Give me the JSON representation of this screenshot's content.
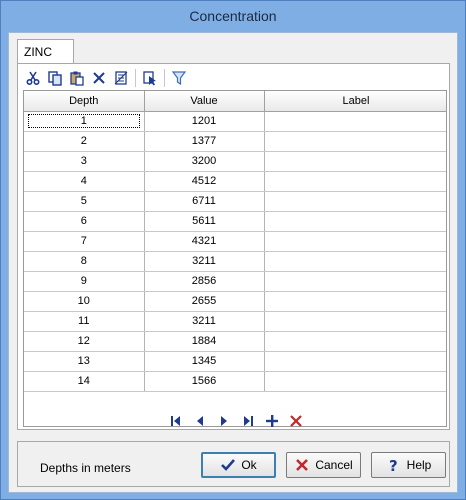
{
  "window": {
    "title": "Concentration"
  },
  "tabs": [
    {
      "label": "ZINC"
    }
  ],
  "toolbar": {
    "items": [
      "cut-icon",
      "copy-icon",
      "paste-icon",
      "delete-icon",
      "clear-icon",
      "select-icon",
      "filter-icon"
    ]
  },
  "grid": {
    "columns": [
      "Depth",
      "Value",
      "Label"
    ],
    "rows": [
      {
        "depth": "1",
        "value": "1201",
        "label": ""
      },
      {
        "depth": "2",
        "value": "1377",
        "label": ""
      },
      {
        "depth": "3",
        "value": "3200",
        "label": ""
      },
      {
        "depth": "4",
        "value": "4512",
        "label": ""
      },
      {
        "depth": "5",
        "value": "6711",
        "label": ""
      },
      {
        "depth": "6",
        "value": "5611",
        "label": ""
      },
      {
        "depth": "7",
        "value": "4321",
        "label": ""
      },
      {
        "depth": "8",
        "value": "3211",
        "label": ""
      },
      {
        "depth": "9",
        "value": "2856",
        "label": ""
      },
      {
        "depth": "10",
        "value": "2655",
        "label": ""
      },
      {
        "depth": "11",
        "value": "3211",
        "label": ""
      },
      {
        "depth": "12",
        "value": "1884",
        "label": ""
      },
      {
        "depth": "13",
        "value": "1345",
        "label": ""
      },
      {
        "depth": "14",
        "value": "1566",
        "label": ""
      }
    ]
  },
  "navigator": {
    "items": [
      "first-record-icon",
      "prior-record-icon",
      "next-record-icon",
      "last-record-icon",
      "add-record-icon",
      "delete-record-icon"
    ]
  },
  "footer": {
    "note": "Depths in meters",
    "ok_label": "Ok",
    "cancel_label": "Cancel",
    "help_label": "Help"
  },
  "colors": {
    "accent": "#1f3b8f",
    "delete": "#c0282a",
    "title_bar": "#7eaee4"
  }
}
